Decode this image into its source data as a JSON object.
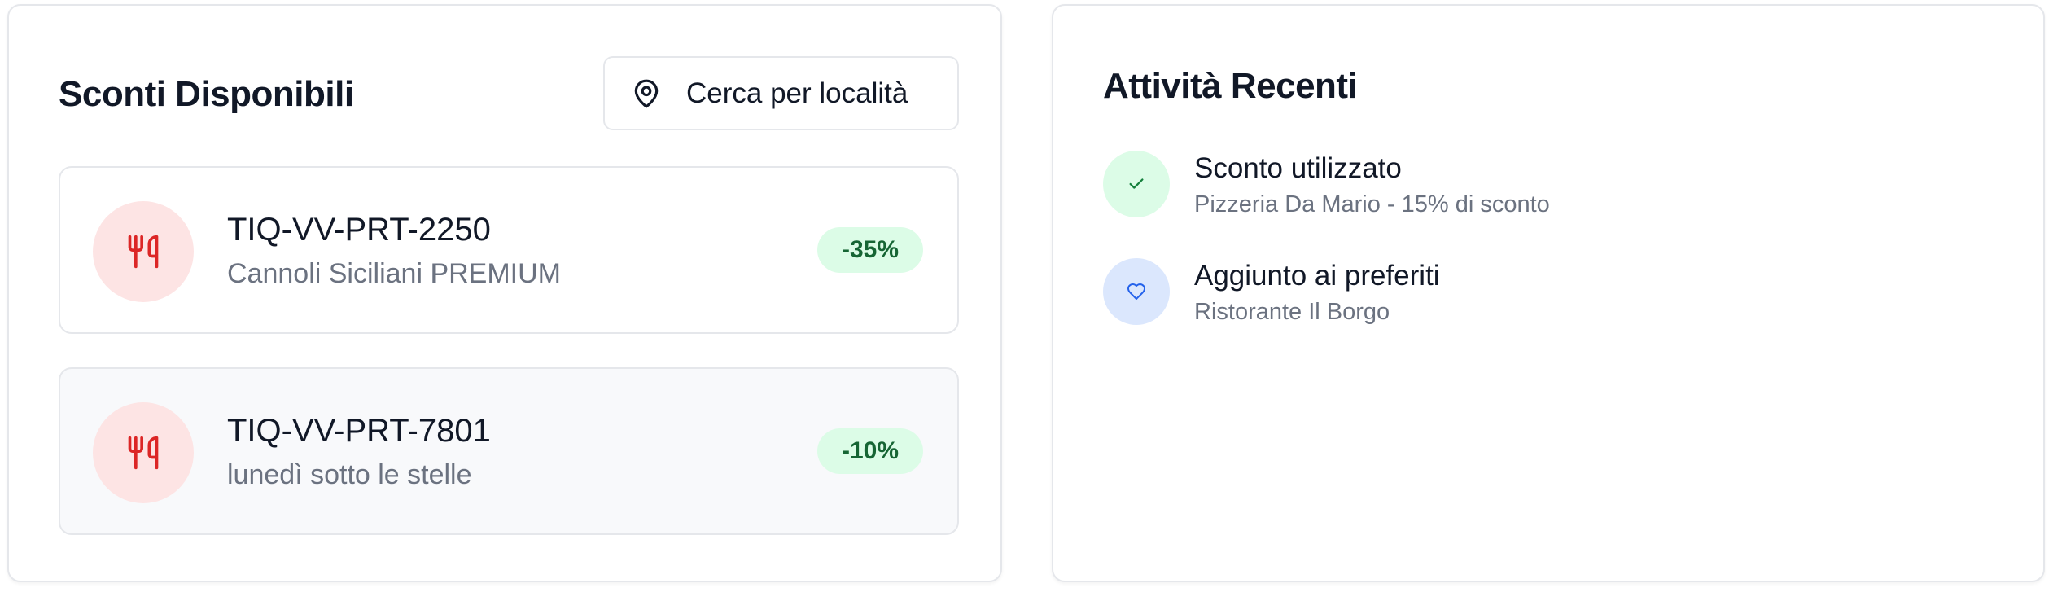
{
  "discounts_panel": {
    "title": "Sconti Disponibili",
    "location_button": {
      "label": "Cerca per località",
      "icon": "map-pin-icon"
    },
    "cards": [
      {
        "code": "TIQ-VV-PRT-2250",
        "name": "Cannoli Siciliani PREMIUM",
        "badge": "-35%",
        "icon": "utensils-icon"
      },
      {
        "code": "TIQ-VV-PRT-7801",
        "name": "lunedì sotto le stelle",
        "badge": "-10%",
        "icon": "utensils-icon"
      }
    ]
  },
  "activity_panel": {
    "title": "Attività Recenti",
    "items": [
      {
        "title": "Sconto utilizzato",
        "subtitle": "Pizzeria Da Mario - 15% di sconto",
        "icon": "check-icon"
      },
      {
        "title": "Aggiunto ai preferiti",
        "subtitle": "Ristorante Il Borgo",
        "icon": "heart-icon"
      }
    ]
  },
  "colors": {
    "accent_red": "#dc2626",
    "badge_green_bg": "#dcfce7",
    "badge_green_text": "#166534",
    "check_bg": "#dcfce7",
    "heart_bg": "#dbe7fd",
    "heart_stroke": "#2563eb"
  }
}
